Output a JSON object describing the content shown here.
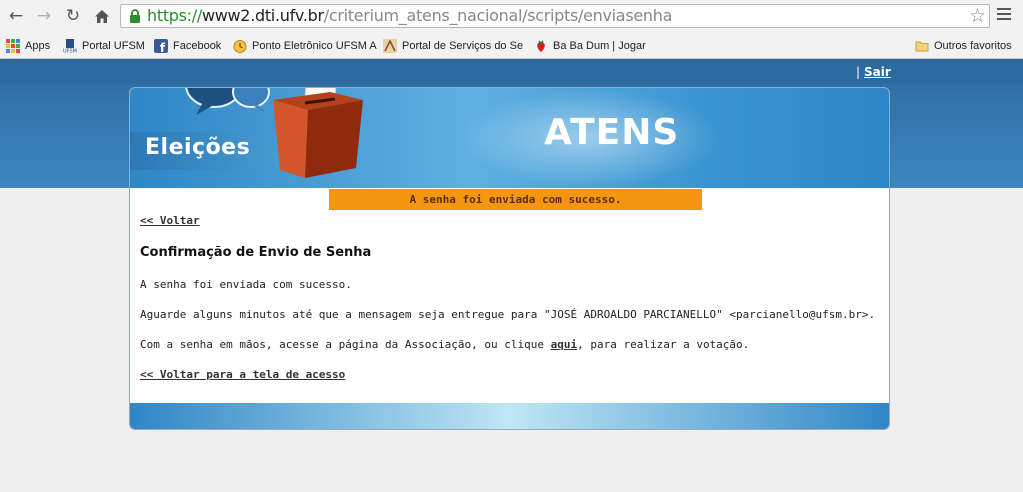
{
  "browser": {
    "url": {
      "scheme": "https://",
      "host": "www2.dti.ufv.br",
      "path": "/criterium_atens_nacional/scripts/enviasenha"
    },
    "bookmarks": [
      {
        "label": "Apps",
        "icon": "apps-grid-icon"
      },
      {
        "label": "Portal UFSM",
        "icon": "ufsm-logo-icon"
      },
      {
        "label": "Facebook",
        "icon": "facebook-icon"
      },
      {
        "label": "Ponto Eletrônico UFSM A",
        "icon": "clock-icon"
      },
      {
        "label": "Portal de Serviços do Se",
        "icon": "portal-servicos-icon"
      },
      {
        "label": "Ba Ba Dum | Jogar",
        "icon": "strawberry-icon"
      }
    ],
    "other_bookmarks": "Outros favoritos"
  },
  "header": {
    "separator": "|",
    "logout_label": "Sair",
    "elections_label": "Eleições",
    "site_title": "ATENS"
  },
  "alert": {
    "message": "A senha foi enviada com sucesso.",
    "color": "#f4960f"
  },
  "content": {
    "back_link": "<< Voltar",
    "heading": "Confirmação de Envio de Senha",
    "success_text": "A senha foi enviada com sucesso.",
    "wait_text": "Aguarde alguns minutos até que a mensagem seja entregue para \"JOSÉ ADROALDO PARCIANELLO\" <parcianello@ufsm.br>.",
    "vote_text_before": "Com a senha em mãos, acesse a página da Associação, ou clique ",
    "vote_link": "aqui",
    "vote_text_after": ", para realizar a votação.",
    "back_to_access": "<< Voltar para a tela de acesso"
  }
}
